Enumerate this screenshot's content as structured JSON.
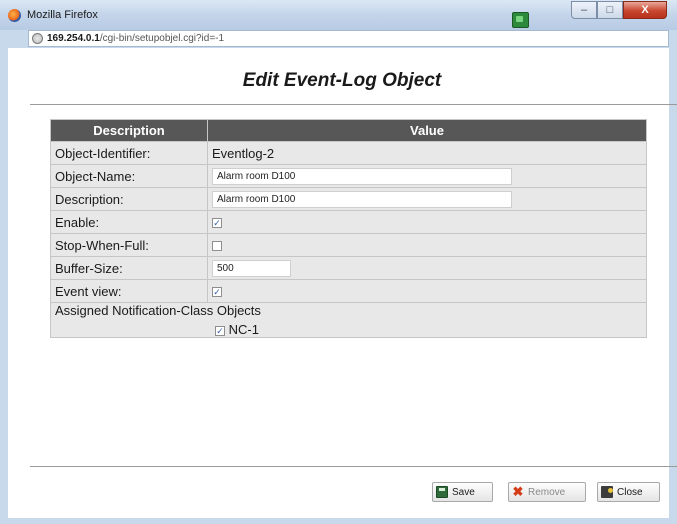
{
  "window": {
    "title": "Mozilla Firefox",
    "url_host": "169.254.0.1",
    "url_path": "/cgi-bin/setupobjel.cgi?id=-1",
    "buttons": {
      "minimize": "–",
      "maximize": "□",
      "close": "X"
    }
  },
  "page": {
    "title": "Edit Event-Log Object"
  },
  "table": {
    "headers": {
      "description": "Description",
      "value": "Value"
    },
    "rows": {
      "object_identifier": {
        "label": "Object-Identifier:",
        "value": "Eventlog-2"
      },
      "object_name": {
        "label": "Object-Name:",
        "value": "Alarm room D100"
      },
      "description": {
        "label": "Description:",
        "value": "Alarm room D100"
      },
      "enable": {
        "label": "Enable:",
        "checked": true
      },
      "stop_when_full": {
        "label": "Stop-When-Full:",
        "checked": false
      },
      "buffer_size": {
        "label": "Buffer-Size:",
        "value": "500"
      },
      "event_view": {
        "label": "Event view:",
        "checked": true
      }
    },
    "assigned": {
      "label": "Assigned Notification-Class Objects",
      "items": [
        {
          "name": "NC-1",
          "checked": true
        }
      ]
    }
  },
  "buttons": {
    "save": "Save",
    "remove": "Remove",
    "close": "Close"
  },
  "colors": {
    "header_bg": "#575757",
    "row_bg": "#e8e8e8",
    "check_color": "#3a62a8"
  },
  "icons": {
    "browser": "firefox-icon",
    "url": "globe-icon",
    "save": "floppy-disk-icon",
    "remove": "red-x-icon",
    "close": "door-exit-icon"
  }
}
